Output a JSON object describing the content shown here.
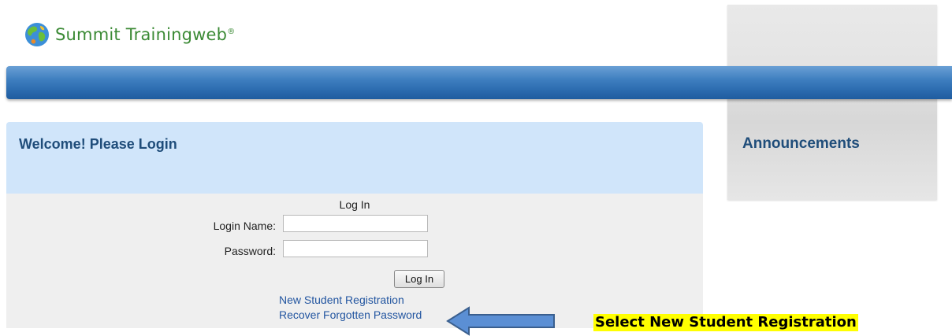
{
  "brand": {
    "name": "Summit Trainingweb",
    "registered_mark": "®"
  },
  "icons": {
    "logo": "globe-icon",
    "pointer": "right-arrow-icon"
  },
  "colors": {
    "brand_green": "#3b8a35",
    "nav_bar_blue": "#2a6aae",
    "welcome_bg": "#d0e5fa",
    "heading_blue": "#1f4d7a",
    "link_blue": "#2255a0",
    "callout_highlight": "#ffff00"
  },
  "welcome": {
    "title": "Welcome! Please Login"
  },
  "announcements": {
    "title": "Announcements"
  },
  "login": {
    "heading": "Log In",
    "login_name_label": "Login Name:",
    "login_name_value": "",
    "password_label": "Password:",
    "password_value": "",
    "submit_label": "Log In"
  },
  "links": {
    "new_registration": "New Student Registration",
    "recover_password": "Recover Forgotten Password"
  },
  "annotation": {
    "callout_text": "Select New Student Registration"
  }
}
